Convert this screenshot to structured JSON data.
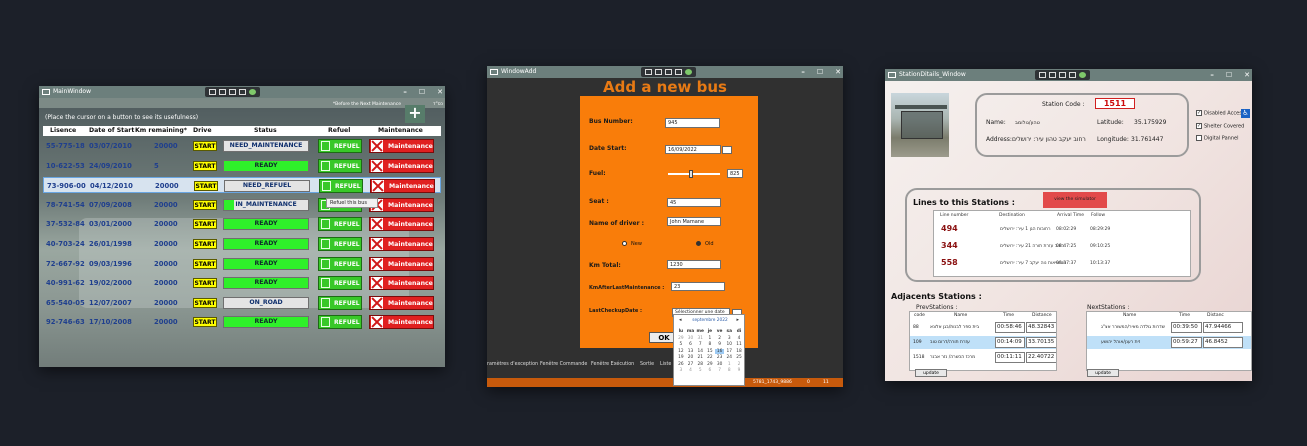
{
  "main_window": {
    "title": "MainWindow",
    "hint": "(Place the cursor on a button to see its usefulness)",
    "note": "*Before the Next Maintenance",
    "corner_label": "כס\"ד",
    "add_icon": "plus-icon",
    "columns": [
      "Lisence",
      "Date of Start",
      "Km remaining*",
      "Drive",
      "Status",
      "Refuel",
      "Maintenance"
    ],
    "start_label": "START",
    "refuel_label": "REFUEL",
    "maintenance_label": "Maintenance",
    "tooltip": "Refuel this bus",
    "rows": [
      {
        "license": "55-775-18",
        "date": "03/07/2010",
        "km": "20000",
        "status": "NEED_MAINTENANCE"
      },
      {
        "license": "10-622-53",
        "date": "24/09/2010",
        "km": "5",
        "status": "READY"
      },
      {
        "license": "73-906-00",
        "date": "04/12/2010",
        "km": "20000",
        "status": "NEED_REFUEL"
      },
      {
        "license": "78-741-54",
        "date": "07/09/2008",
        "km": "20000",
        "status": "IN_MAINTENANCE"
      },
      {
        "license": "37-532-84",
        "date": "03/01/2000",
        "km": "20000",
        "status": "READY"
      },
      {
        "license": "40-703-24",
        "date": "26/01/1998",
        "km": "20000",
        "status": "READY"
      },
      {
        "license": "72-667-92",
        "date": "09/03/1996",
        "km": "20000",
        "status": "READY"
      },
      {
        "license": "40-991-62",
        "date": "19/02/2000",
        "km": "20000",
        "status": "READY"
      },
      {
        "license": "65-540-05",
        "date": "12/07/2007",
        "km": "20000",
        "status": "ON_ROAD"
      },
      {
        "license": "92-746-63",
        "date": "17/10/2008",
        "km": "20000",
        "status": "READY"
      }
    ]
  },
  "add_window": {
    "title": "WindowAdd",
    "heading": "Add a new bus",
    "bus_number_label": "Bus Number:",
    "bus_number": "945",
    "date_start_label": "Date Start:",
    "date_start": "16/09/2022",
    "fuel_label": "Fuel:",
    "fuel_value": "825",
    "fuel_level": 0.45,
    "seat_label": "Seat :",
    "seat": "45",
    "driver_label": "Name of driver :",
    "driver": "John Mamane",
    "radio_new": "New",
    "radio_old": "Old",
    "km_total_label": "Km Total:",
    "km_total": "1230",
    "km_after_label": "KmAfterLastMaintenance :",
    "km_after": "23",
    "last_checkup_label": "LastCheckupDate :",
    "last_checkup_placeholder": "Sélectionner une date",
    "ok_label": "OK",
    "calendar": {
      "month": "septembre 2022",
      "days_header": [
        "lu",
        "ma",
        "me",
        "je",
        "ve",
        "sa",
        "di"
      ],
      "cells": [
        "29",
        "30",
        "31",
        "1",
        "2",
        "3",
        "4",
        "5",
        "6",
        "7",
        "8",
        "9",
        "10",
        "11",
        "12",
        "13",
        "14",
        "15",
        "16",
        "17",
        "18",
        "19",
        "20",
        "21",
        "22",
        "23",
        "24",
        "25",
        "26",
        "27",
        "28",
        "29",
        "30",
        "1",
        "2",
        "3",
        "4",
        "5",
        "6",
        "7",
        "8",
        "9"
      ]
    },
    "vs_tabs": [
      "ramètres d'exception",
      "Fenêtre Commande",
      "Fenêtre Exécution",
      "Sortie",
      "Liste"
    ],
    "status_right": [
      "5781_1743_9886",
      "0",
      "11"
    ]
  },
  "station_window": {
    "title": "StationDitails_Window",
    "station_code_label": "Station Code :",
    "station_code": "1511",
    "name_label": "Name:",
    "name": "טהון/גולומב",
    "address_label": "Address:",
    "address": "רחוב יעקב טהון  עיר: ירושלים",
    "latitude_label": "Latitude:",
    "latitude": "35.175929",
    "longitude_label": "Longitude:",
    "longitude": "31.761447",
    "checks": [
      {
        "label": "Disabled Access",
        "checked": true
      },
      {
        "label": "Shelter Covered",
        "checked": true
      },
      {
        "label": "Digital Pannel",
        "checked": false
      }
    ],
    "lines_heading": "Lines to this Stations :",
    "simulator_label": "view the simulator",
    "lines_columns": [
      "Line number",
      "Destination",
      "Arrival Time",
      "Follow"
    ],
    "lines": [
      {
        "num": "494",
        "dest": "רחובות הגן 1 עיר: ירושלים",
        "arr": "08:02:29",
        "follow": "08:29:29"
      },
      {
        "num": "344",
        "dest": "רחוב עזרת תורה 21 עיר: ירושלים",
        "arr": "08:47:25",
        "follow": "09:10:25"
      },
      {
        "num": "558",
        "dest": "חובשיאות נוה יעקב 7 עיר: ירושלים",
        "arr": "08:37:37",
        "follow": "10:13:37"
      }
    ],
    "adjacent_heading": "Adjacents Stations :",
    "prev_label": "PrevStations :",
    "next_label": "NextStations :",
    "prev_columns": [
      "code",
      "Name",
      "Time",
      "Distance"
    ],
    "next_columns": [
      "Name",
      "Time",
      "Distanc"
    ],
    "prev_rows": [
      {
        "code": "88",
        "name": "בית ספר לבנות/בגן אלונא",
        "time": "00:58:46",
        "dist": "48.32843"
      },
      {
        "code": "109",
        "name": "עזרת תורה/דרום טוב",
        "time": "00:14:09",
        "dist": "33.70135"
      },
      {
        "code": "1518",
        "name": "מרכז הכשרה/ נזר אבנר",
        "time": "00:11:11",
        "dist": "22.40722"
      }
    ],
    "next_rows": [
      {
        "name": "שדרות גולדה מאיר/המשורר אצ\"ג",
        "time": "00:39:50",
        "dist": "47.94466"
      },
      {
        "name": "זית רענן/אוהל יהושע",
        "time": "00:59:27",
        "dist": "46.8452"
      }
    ],
    "update_label": "update"
  }
}
